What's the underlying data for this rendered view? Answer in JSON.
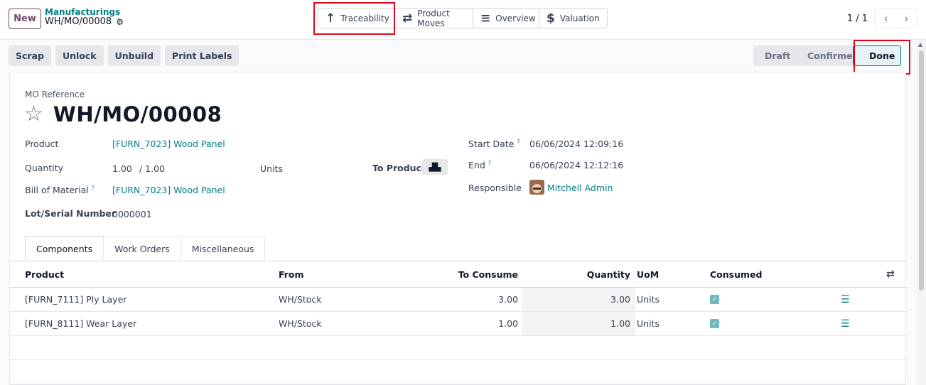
{
  "header": {
    "new_label": "New",
    "breadcrumb_parent": "Manufacturings",
    "breadcrumb_current": "WH/MO/00008",
    "pager_text": "1 / 1"
  },
  "smart_buttons": [
    {
      "label": "Traceability",
      "icon": "arrow-up-icon"
    },
    {
      "label": "Product Moves",
      "icon": "exchange-icon"
    },
    {
      "label": "Overview",
      "icon": "bars-icon"
    },
    {
      "label": "Valuation",
      "icon": "dollar-icon"
    }
  ],
  "action_buttons": [
    "Scrap",
    "Unlock",
    "Unbuild",
    "Print Labels"
  ],
  "status_bar": [
    "Draft",
    "Confirmed",
    "Done"
  ],
  "status_current": "Done",
  "form": {
    "ref_label": "MO Reference",
    "ref_value": "WH/MO/00008",
    "product_label": "Product",
    "product_value": "[FURN_7023] Wood Panel",
    "quantity_label": "Quantity",
    "quantity_value": "1.00",
    "quantity_total": "/ 1.00",
    "uom": "Units",
    "to_produce_label": "To Produce",
    "bom_label": "Bill of Material",
    "bom_value": "[FURN_7023] Wood Panel",
    "lot_label": "Lot/Serial Number",
    "lot_value": "0000001",
    "start_label": "Start Date",
    "start_value": "06/06/2024 12:09:16",
    "end_label": "End",
    "end_value": "06/06/2024 12:12:16",
    "responsible_label": "Responsible",
    "responsible_value": "Mitchell Admin",
    "help_mark": "?"
  },
  "tabs": [
    "Components",
    "Work Orders",
    "Miscellaneous"
  ],
  "table": {
    "headers": [
      "Product",
      "From",
      "To Consume",
      "Quantity",
      "UoM",
      "Consumed"
    ],
    "rows": [
      {
        "product": "[FURN_7111] Ply Layer",
        "from": "WH/Stock",
        "to_consume": "3.00",
        "quantity": "3.00",
        "uom": "Units"
      },
      {
        "product": "[FURN_8111] Wear Layer",
        "from": "WH/Stock",
        "to_consume": "1.00",
        "quantity": "1.00",
        "uom": "Units"
      }
    ]
  },
  "colors": {
    "accent": "#017e84",
    "brand": "#714b67",
    "highlight": "#e0081d"
  }
}
